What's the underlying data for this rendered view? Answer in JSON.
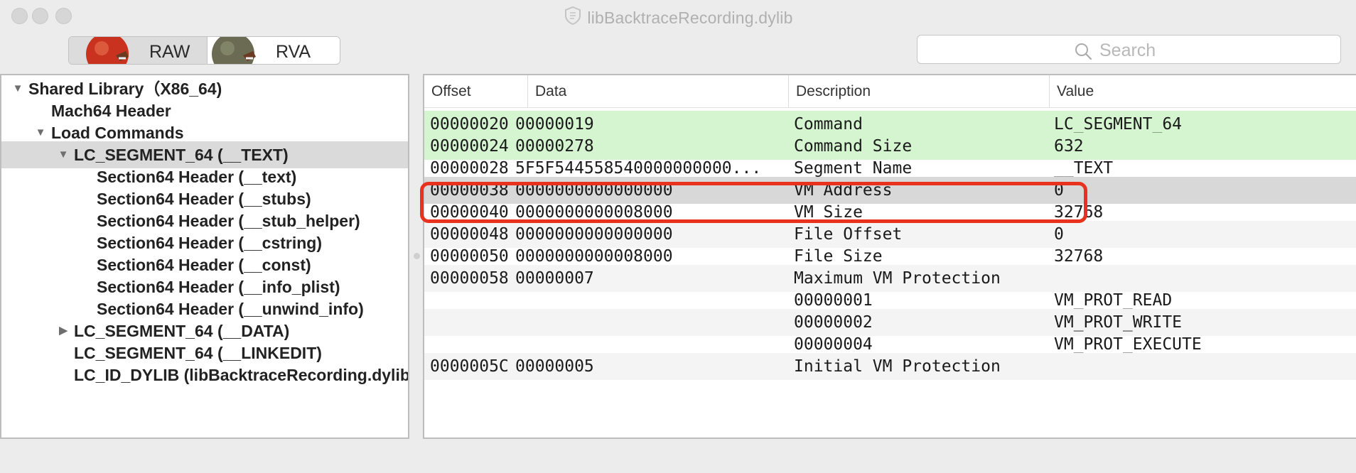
{
  "window": {
    "title": "libBacktraceRecording.dylib"
  },
  "toolbar": {
    "raw_label": "RAW",
    "rva_label": "RVA",
    "selected": "RAW"
  },
  "search": {
    "placeholder": "Search"
  },
  "tree": {
    "items": [
      {
        "label": "Shared Library（X86_64)",
        "expanded": true
      },
      {
        "label": "Mach64 Header"
      },
      {
        "label": "Load Commands",
        "expanded": true
      },
      {
        "label": "LC_SEGMENT_64 (__TEXT)",
        "expanded": true,
        "selected": true
      },
      {
        "label": "Section64 Header (__text)"
      },
      {
        "label": "Section64 Header (__stubs)"
      },
      {
        "label": "Section64 Header (__stub_helper)"
      },
      {
        "label": "Section64 Header (__cstring)"
      },
      {
        "label": "Section64 Header (__const)"
      },
      {
        "label": "Section64 Header (__info_plist)"
      },
      {
        "label": "Section64 Header (__unwind_info)"
      },
      {
        "label": "LC_SEGMENT_64 (__DATA)",
        "expanded": false
      },
      {
        "label": "LC_SEGMENT_64 (__LINKEDIT)"
      },
      {
        "label": "LC_ID_DYLIB (libBacktraceRecording.dylib)"
      }
    ]
  },
  "table": {
    "columns": [
      "Offset",
      "Data",
      "Description",
      "Value"
    ],
    "rows": [
      {
        "offset": "00000020",
        "data": "00000019",
        "description": "Command",
        "value": "LC_SEGMENT_64",
        "highlight": "green"
      },
      {
        "offset": "00000024",
        "data": "00000278",
        "description": "Command Size",
        "value": "632",
        "highlight": "green"
      },
      {
        "offset": "00000028",
        "data": "5F5F544558540000000000...",
        "description": "Segment Name",
        "value": "__TEXT"
      },
      {
        "offset": "00000038",
        "data": "0000000000000000",
        "description": "VM Address",
        "value": "0",
        "highlight": "selected",
        "annotated": true
      },
      {
        "offset": "00000040",
        "data": "0000000000008000",
        "description": "VM Size",
        "value": "32768"
      },
      {
        "offset": "00000048",
        "data": "0000000000000000",
        "description": "File Offset",
        "value": "0"
      },
      {
        "offset": "00000050",
        "data": "0000000000008000",
        "description": "File Size",
        "value": "32768"
      },
      {
        "offset": "00000058",
        "data": "00000007",
        "description": "Maximum VM Protection",
        "value": ""
      },
      {
        "offset": "",
        "data": "",
        "description": "00000001",
        "value": "VM_PROT_READ"
      },
      {
        "offset": "",
        "data": "",
        "description": "00000002",
        "value": "VM_PROT_WRITE"
      },
      {
        "offset": "",
        "data": "",
        "description": "00000004",
        "value": "VM_PROT_EXECUTE"
      },
      {
        "offset": "0000005C",
        "data": "00000005",
        "description": "Initial VM Protection",
        "value": ""
      }
    ]
  },
  "colors": {
    "highlight_green": "#d5f5d0",
    "selection_gray": "#d8d8d8",
    "annotation_red": "#e8321e"
  },
  "icons": {
    "document": "shield-document-icon",
    "search": "magnifier-search-icon",
    "raw": "red-apple-chart-icon",
    "rva": "green-helmet-chart-icon"
  }
}
